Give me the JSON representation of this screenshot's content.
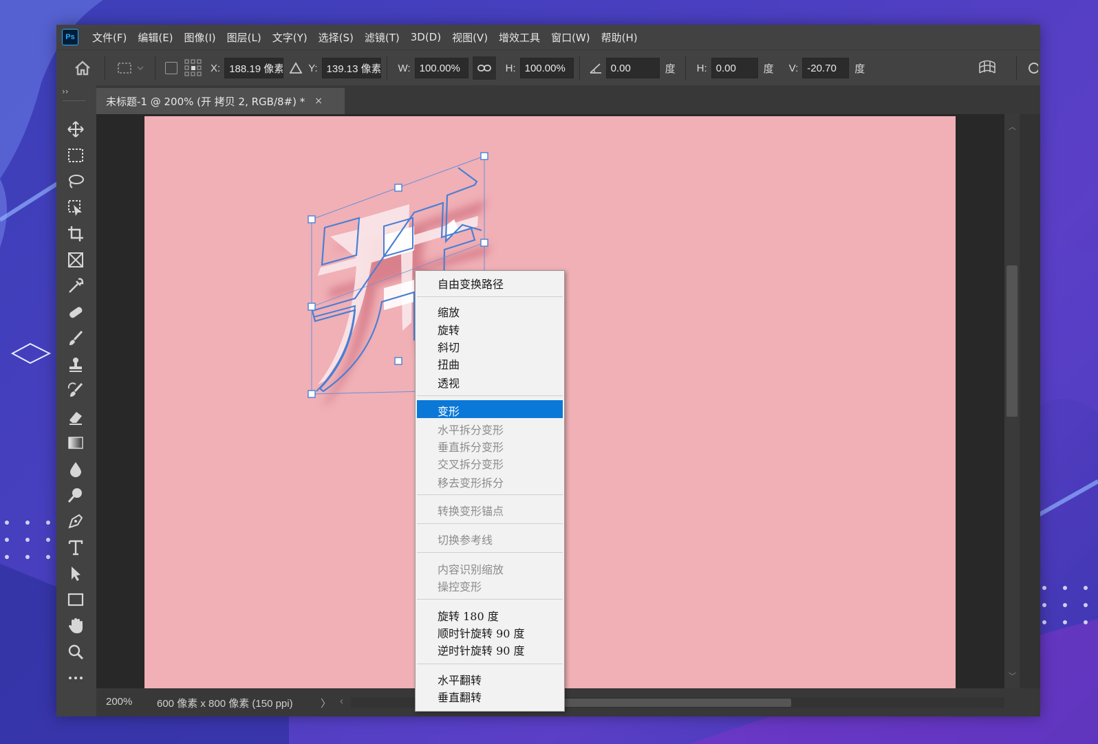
{
  "app": {
    "logo": "Ps"
  },
  "menu": [
    "文件(F)",
    "编辑(E)",
    "图像(I)",
    "图层(L)",
    "文字(Y)",
    "选择(S)",
    "滤镜(T)",
    "3D(D)",
    "视图(V)",
    "增效工具",
    "窗口(W)",
    "帮助(H)"
  ],
  "options": {
    "x_label": "X:",
    "x_value": "188.19 像素",
    "y_label": "Y:",
    "y_value": "139.13 像素",
    "w_label": "W:",
    "w_value": "100.00%",
    "h_label": "H:",
    "h_value": "100.00%",
    "angle_value": "0.00",
    "angle_unit": "度",
    "hskew_label": "H:",
    "hskew_value": "0.00",
    "hskew_unit": "度",
    "vskew_label": "V:",
    "vskew_value": "-20.70",
    "vskew_unit": "度"
  },
  "document": {
    "tab_title": "未标题-1 @ 200% (开 拷贝 2, RGB/8#) *",
    "close": "×",
    "canvas_color": "#f0b0b6",
    "glyph": "开"
  },
  "status": {
    "zoom": "200%",
    "doc_info": "600 像素 x 800 像素 (150 ppi)",
    "arrow": "〉",
    "left_arrow": "‹"
  },
  "context_menu": {
    "items": [
      {
        "label": "自由变换路径",
        "enabled": true
      },
      {
        "label": "缩放",
        "enabled": true
      },
      {
        "label": "旋转",
        "enabled": true
      },
      {
        "label": "斜切",
        "enabled": true
      },
      {
        "label": "扭曲",
        "enabled": true
      },
      {
        "label": "透视",
        "enabled": true
      },
      {
        "label": "变形",
        "enabled": true,
        "highlighted": true
      },
      {
        "label": "水平拆分变形",
        "enabled": false
      },
      {
        "label": "垂直拆分变形",
        "enabled": false
      },
      {
        "label": "交叉拆分变形",
        "enabled": false
      },
      {
        "label": "移去变形拆分",
        "enabled": false
      },
      {
        "label": "转换变形锚点",
        "enabled": false
      },
      {
        "label": "切换参考线",
        "enabled": false
      },
      {
        "label": "内容识别缩放",
        "enabled": false
      },
      {
        "label": "操控变形",
        "enabled": false
      },
      {
        "label": "旋转 180 度",
        "enabled": true
      },
      {
        "label": "顺时针旋转 90 度",
        "enabled": true
      },
      {
        "label": "逆时针旋转 90 度",
        "enabled": true
      },
      {
        "label": "水平翻转",
        "enabled": true
      },
      {
        "label": "垂直翻转",
        "enabled": true
      }
    ]
  },
  "colors": {
    "accent": "#0a78d7",
    "path": "#4a7fd4",
    "canvas": "#f0b0b6"
  },
  "tools": [
    "move-tool-icon",
    "marquee-tool-icon",
    "lasso-tool-icon",
    "object-select-tool-icon",
    "crop-tool-icon",
    "frame-tool-icon",
    "eyedropper-tool-icon",
    "healing-brush-tool-icon",
    "brush-tool-icon",
    "stamp-tool-icon",
    "history-brush-tool-icon",
    "eraser-tool-icon",
    "gradient-tool-icon",
    "blur-tool-icon",
    "dodge-tool-icon",
    "pen-tool-icon",
    "type-tool-icon",
    "path-select-tool-icon",
    "rectangle-tool-icon",
    "hand-tool-icon",
    "zoom-tool-icon",
    "more-tools-icon"
  ]
}
